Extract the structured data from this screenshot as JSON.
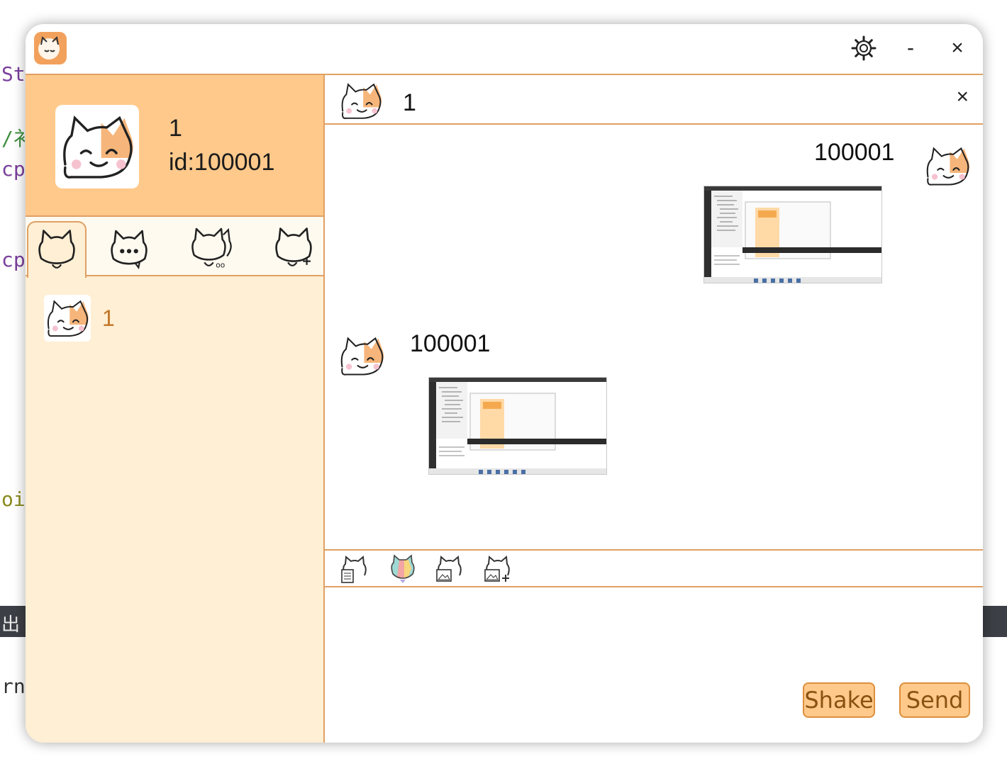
{
  "background": {
    "code_fragments": [
      {
        "text": "St",
        "color": "#7b3f9c"
      },
      {
        "text": "/衤",
        "color": "#3e8e3e"
      },
      {
        "text": "cp",
        "color": "#7b3f9c"
      },
      {
        "text": "cp",
        "color": "#7b3f9c"
      },
      {
        "text": "oi",
        "color": "#8a8a20"
      },
      {
        "text": "rn",
        "color": "#333333"
      }
    ],
    "bar_text": "出"
  },
  "window": {
    "app_icon": "cat-app-icon",
    "settings_icon": "gear-icon",
    "minimize_label": "-",
    "close_label": "×"
  },
  "profile": {
    "name": "1",
    "id_text": "id:100001",
    "avatar_icon": "cat-avatar-icon"
  },
  "tabs": [
    {
      "icon": "cat-contacts-icon",
      "active": true
    },
    {
      "icon": "cat-messages-icon",
      "active": false
    },
    {
      "icon": "cat-group-icon",
      "active": false
    },
    {
      "icon": "cat-add-friend-icon",
      "active": false
    }
  ],
  "friends": [
    {
      "name": "1",
      "avatar_icon": "cat-avatar-icon"
    }
  ],
  "chat": {
    "title": "1",
    "close_label": "×",
    "messages": [
      {
        "sender": "100001",
        "side": "right",
        "content": "screenshot-image"
      },
      {
        "sender": "100001",
        "side": "left",
        "content": "screenshot-image"
      }
    ]
  },
  "toolbar": [
    {
      "icon": "cat-file-icon"
    },
    {
      "icon": "cat-color-icon"
    },
    {
      "icon": "cat-image-icon"
    },
    {
      "icon": "cat-image-add-icon"
    }
  ],
  "actions": {
    "shake_label": "Shake",
    "send_label": "Send"
  },
  "colors": {
    "accent": "#ffc98b",
    "panel": "#ffefd4",
    "border": "#e0a063",
    "friend_text": "#c27626"
  }
}
